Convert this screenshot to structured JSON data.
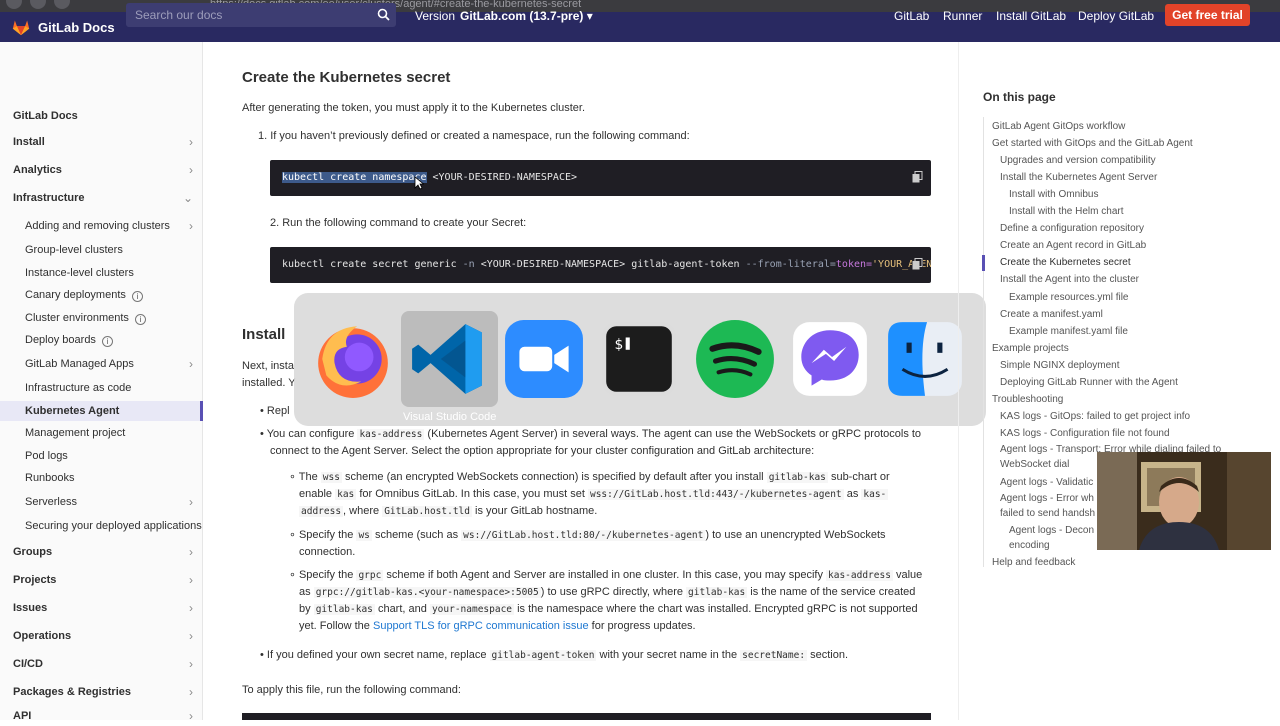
{
  "browser": {
    "url": "https://docs.gitlab.com/ee/user/clusters/agent/#create-the-kubernetes-secret"
  },
  "navbar": {
    "brand": "GitLab Docs",
    "search_placeholder": "Search our docs",
    "version_label": "Version",
    "version_value": "GitLab.com (13.7-pre) ▾",
    "links": [
      "GitLab",
      "Runner",
      "Install GitLab",
      "Deploy GitLab"
    ],
    "cta": "Get free trial",
    "brand_color": "#292961",
    "cta_color": "#e24329"
  },
  "sidebar": {
    "items": [
      {
        "label": "GitLab Docs",
        "level": "top",
        "chevron": ""
      },
      {
        "label": "Install",
        "level": "top",
        "chevron": "›"
      },
      {
        "label": "Analytics",
        "level": "top",
        "chevron": "›"
      },
      {
        "label": "Infrastructure",
        "level": "top",
        "chevron": "⌄"
      },
      {
        "label": "Adding and removing clusters",
        "level": "sub",
        "chevron": "›"
      },
      {
        "label": "Group-level clusters",
        "level": "sub",
        "chevron": ""
      },
      {
        "label": "Instance-level clusters",
        "level": "sub",
        "chevron": ""
      },
      {
        "label": "Canary deployments",
        "level": "sub",
        "chevron": "",
        "info": true
      },
      {
        "label": "Cluster environments",
        "level": "sub",
        "chevron": "",
        "info": true
      },
      {
        "label": "Deploy boards",
        "level": "sub",
        "chevron": "",
        "info": true
      },
      {
        "label": "GitLab Managed Apps",
        "level": "sub",
        "chevron": "›"
      },
      {
        "label": "Infrastructure as code",
        "level": "sub",
        "chevron": ""
      },
      {
        "label": "Kubernetes Agent",
        "level": "sub",
        "chevron": "",
        "active": true
      },
      {
        "label": "Management project",
        "level": "sub",
        "chevron": ""
      },
      {
        "label": "Pod logs",
        "level": "sub",
        "chevron": ""
      },
      {
        "label": "Runbooks",
        "level": "sub",
        "chevron": ""
      },
      {
        "label": "Serverless",
        "level": "sub",
        "chevron": "›"
      },
      {
        "label": "Securing your deployed applications",
        "level": "sub",
        "chevron": ""
      },
      {
        "label": "Groups",
        "level": "top",
        "chevron": "›"
      },
      {
        "label": "Projects",
        "level": "top",
        "chevron": "›"
      },
      {
        "label": "Issues",
        "level": "top",
        "chevron": "›"
      },
      {
        "label": "Operations",
        "level": "top",
        "chevron": "›"
      },
      {
        "label": "CI/CD",
        "level": "top",
        "chevron": "›"
      },
      {
        "label": "Packages & Registries",
        "level": "top",
        "chevron": "›"
      },
      {
        "label": "API",
        "level": "top",
        "chevron": "›"
      }
    ],
    "info_glyph": "i"
  },
  "main": {
    "heading": "Create the Kubernetes secret",
    "intro": "After generating the token, you must apply it to the Kubernetes cluster.",
    "step1": "1. If you haven’t previously defined or created a namespace, run the following command:",
    "code1_selected": "kubectl create namespace",
    "code1_rest": " <YOUR-DESIRED-NAMESPACE>",
    "step2": "2. Run the following command to create your Secret:",
    "code2_a": "kubectl create secret generic ",
    "code2_b": "-n ",
    "code2_c": "<YOUR-DESIRED-NAMESPACE> gitlab-agent-token ",
    "code2_d": "--from-literal=",
    "code2_e": "token=",
    "code2_f": "'YOUR_AGENT_",
    "install_heading": "Install",
    "next_text_a": "Next, insta",
    "next_text_b": "installed. Y",
    "bullet_repl": "Repl",
    "configure_a": "You can configure ",
    "configure_code": "kas-address",
    "configure_b": " (Kubernetes Agent Server) in several ways. The agent can use the WebSockets or gRPC protocols to",
    "configure_c": "connect to the Agent Server. Select the option appropriate for your cluster configuration and GitLab architecture:",
    "wss_1a": "The ",
    "wss_1code": "wss",
    "wss_1b": " scheme (an encrypted WebSockets connection) is specified by default after you install ",
    "wss_1code2": "gitlab-kas",
    "wss_1c": " sub-chart or",
    "wss_2a": "enable ",
    "wss_2code": "kas",
    "wss_2b": " for Omnibus GitLab. In this case, you must set ",
    "wss_2code2": "wss://GitLab.host.tld:443/-/kubernetes-agent",
    "wss_2c": " as ",
    "wss_2code3": "kas-",
    "wss_3code": "address",
    "wss_3a": ", where ",
    "wss_3code2": "GitLab.host.tld",
    "wss_3b": " is your GitLab hostname.",
    "ws_1a": "Specify the ",
    "ws_1code": "ws",
    "ws_1b": " scheme (such as ",
    "ws_1code2": "ws://GitLab.host.tld:80/-/kubernetes-agent",
    "ws_1c": ") to use an unencrypted WebSockets",
    "ws_2": "connection.",
    "grpc_1a": "Specify the ",
    "grpc_1code": "grpc",
    "grpc_1b": " scheme if both Agent and Server are installed in one cluster. In this case, you may specify ",
    "grpc_1code2": "kas-address",
    "grpc_1c": " value",
    "grpc_2a": "as ",
    "grpc_2code": "grpc://gitlab-kas.<your-namespace>:5005",
    "grpc_2b": ") to use gRPC directly, where ",
    "grpc_2code2": "gitlab-kas",
    "grpc_2c": " is the name of the service created",
    "grpc_3a": "by ",
    "grpc_3code": "gitlab-kas",
    "grpc_3b": " chart, and ",
    "grpc_3code2": "your-namespace",
    "grpc_3c": " is the namespace where the chart was installed. Encrypted gRPC is not supported",
    "grpc_4a": "yet. Follow the ",
    "grpc_4link": "Support TLS for gRPC communication issue",
    "grpc_4b": " for progress updates.",
    "secret_a": "If you defined your own secret name, replace ",
    "secret_code": "gitlab-agent-token",
    "secret_b": " with your secret name in the ",
    "secret_code2": "secretName:",
    "secret_c": " section.",
    "apply": "To apply this file, run the following command:"
  },
  "dock": {
    "apps": [
      "Firefox",
      "Visual Studio Code",
      "Zoom",
      "Terminal",
      "Spotify",
      "Messenger",
      "Finder"
    ],
    "selected_label": "Visual Studio Code"
  },
  "toc": {
    "title": "On this page",
    "items": [
      {
        "label": "GitLab Agent GitOps workflow",
        "level": 1
      },
      {
        "label": "Get started with GitOps and the GitLab Agent",
        "level": 1
      },
      {
        "label": "Upgrades and version compatibility",
        "level": 2
      },
      {
        "label": "Install the Kubernetes Agent Server",
        "level": 2
      },
      {
        "label": "Install with Omnibus",
        "level": 3
      },
      {
        "label": "Install with the Helm chart",
        "level": 3
      },
      {
        "label": "Define a configuration repository",
        "level": 2
      },
      {
        "label": "Create an Agent record in GitLab",
        "level": 2
      },
      {
        "label": "Create the Kubernetes secret",
        "level": 2,
        "active": true
      },
      {
        "label": "Install the Agent into the cluster",
        "level": 2
      },
      {
        "label": "Example resources.yml file",
        "level": 3
      },
      {
        "label": "Create a manifest.yaml",
        "level": 2
      },
      {
        "label": "Example manifest.yaml file",
        "level": 3
      },
      {
        "label": "Example projects",
        "level": 1
      },
      {
        "label": "Simple NGINX deployment",
        "level": 2
      },
      {
        "label": "Deploying GitLab Runner with the Agent",
        "level": 2
      },
      {
        "label": "Troubleshooting",
        "level": 1
      },
      {
        "label": "KAS logs - GitOps: failed to get project info",
        "level": 2
      },
      {
        "label": "KAS logs - Configuration file not found",
        "level": 2
      },
      {
        "label": "Agent logs - Transport: Error while dialing failed to",
        "level": 2
      },
      {
        "label": "WebSocket dial",
        "level": 2
      },
      {
        "label": "Agent logs - Validatic",
        "level": 2
      },
      {
        "label": "Agent logs - Error wh",
        "level": 2
      },
      {
        "label": "failed to send handsh",
        "level": 2
      },
      {
        "label": "Agent logs - Decon",
        "level": 3
      },
      {
        "label": "encoding",
        "level": 3
      },
      {
        "label": "Help and feedback",
        "level": 1
      }
    ]
  }
}
